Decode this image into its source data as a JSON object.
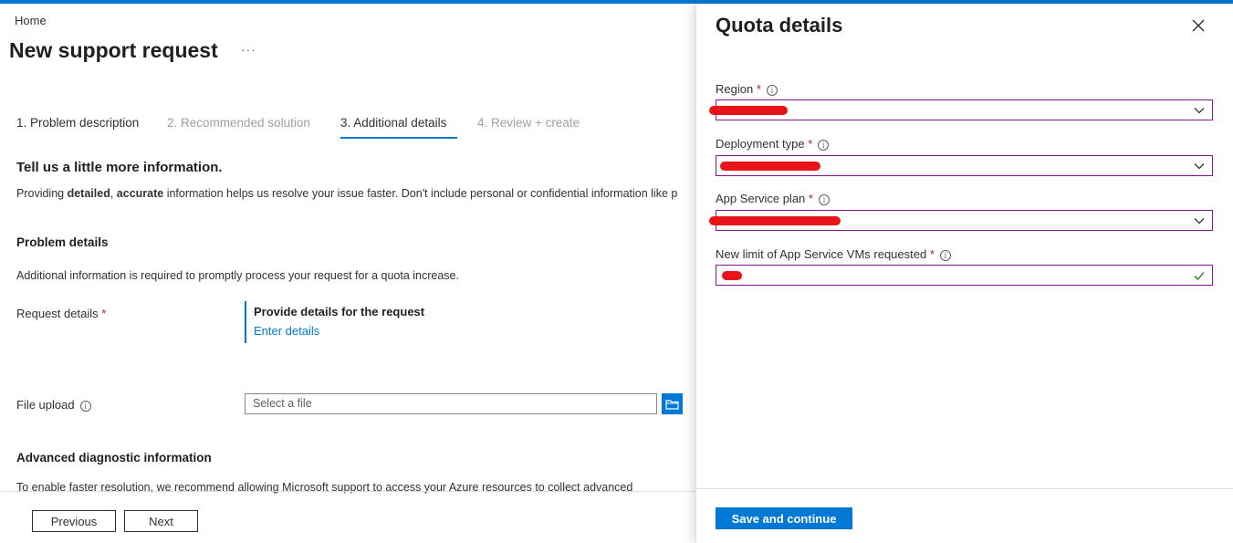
{
  "breadcrumb": "Home",
  "page": {
    "title": "New support request",
    "more": "···"
  },
  "steps": [
    {
      "label": "1. Problem description",
      "state": "done"
    },
    {
      "label": "2. Recommended solution",
      "state": "disabled"
    },
    {
      "label": "3. Additional details",
      "state": "active"
    },
    {
      "label": "4. Review + create",
      "state": "disabled"
    }
  ],
  "intro": {
    "heading": "Tell us a little more information.",
    "text_1": "Providing ",
    "bold_1": "detailed",
    "text_2": ", ",
    "bold_2": "accurate",
    "text_3": " information helps us resolve your issue faster. Don't include personal or confidential information like p"
  },
  "problem_details": {
    "heading": "Problem details",
    "description": "Additional information is required to promptly process your request for a quota increase.",
    "request_label": "Request details",
    "required_mark": "*",
    "box_title": "Provide details for the request",
    "box_link": "Enter details",
    "file_label": "File upload",
    "file_placeholder": "Select a file"
  },
  "advanced": {
    "heading": "Advanced diagnostic information",
    "text": "To enable faster resolution, we recommend allowing Microsoft support to access your Azure resources to collect advanced"
  },
  "footer": {
    "previous": "Previous",
    "next": "Next"
  },
  "panel": {
    "title": "Quota details",
    "fields": [
      {
        "label": "Region",
        "required": "*"
      },
      {
        "label": "Deployment type",
        "required": "*"
      },
      {
        "label": "App Service plan",
        "required": "*"
      },
      {
        "label": "New limit of App Service VMs requested",
        "required": "*"
      }
    ],
    "save_label": "Save and continue"
  },
  "colors": {
    "accent": "#0078d4",
    "field_border": "#881798",
    "required": "#a4262c",
    "redaction": "#e8141a",
    "valid": "#107c10"
  }
}
